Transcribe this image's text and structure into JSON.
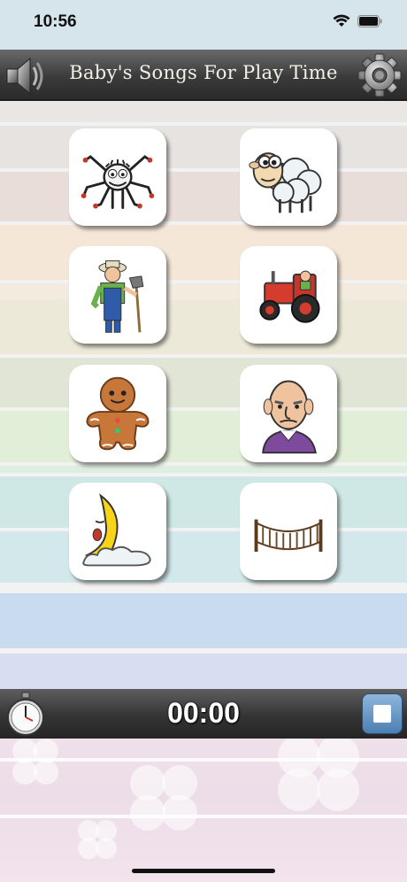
{
  "status": {
    "time": "10:56"
  },
  "header": {
    "title": "Baby's Songs For Play Time"
  },
  "songs": [
    {
      "icon": "spider-icon"
    },
    {
      "icon": "sheep-icon"
    },
    {
      "icon": "farmer-icon"
    },
    {
      "icon": "tractor-icon"
    },
    {
      "icon": "gingerbread-man-icon"
    },
    {
      "icon": "old-man-icon"
    },
    {
      "icon": "sleepy-moon-icon"
    },
    {
      "icon": "rope-bridge-icon"
    }
  ],
  "timer": {
    "value": "00:00"
  },
  "colors": {
    "header": "#3b3b3b",
    "stop_button": "#4b7fb3",
    "stripe_colors": [
      "#e9e6e3",
      "#e8ddd9",
      "#f5e7d8",
      "#ede9d9",
      "#e1e5d5",
      "#e2efd8",
      "#cfe8e6",
      "#d2e8ea",
      "#c9dbee",
      "#d8ddf2"
    ]
  }
}
